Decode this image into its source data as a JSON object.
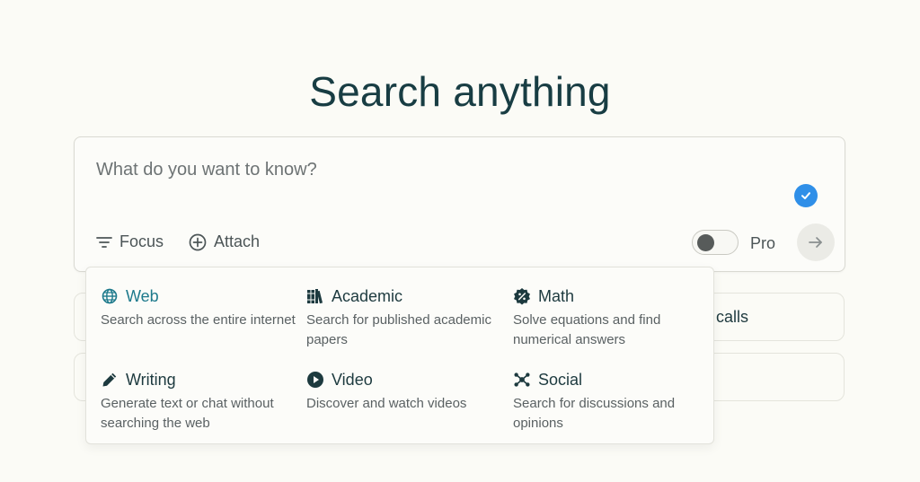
{
  "heading": "Search anything",
  "search": {
    "placeholder": "What do you want to know?",
    "focus_label": "Focus",
    "attach_label": "Attach",
    "pro_label": "Pro",
    "pro_enabled": false
  },
  "background_cards": [
    {
      "visible_text": "calls"
    },
    {
      "visible_text": ""
    }
  ],
  "focus_menu": {
    "options": [
      {
        "label": "Web",
        "description": "Search across the entire internet",
        "icon": "globe-icon",
        "selected": true
      },
      {
        "label": "Academic",
        "description": "Search for published academic papers",
        "icon": "books-icon",
        "selected": false
      },
      {
        "label": "Math",
        "description": "Solve equations and find numerical answers",
        "icon": "percent-badge-icon",
        "selected": false
      },
      {
        "label": "Writing",
        "description": "Generate text or chat without searching the web",
        "icon": "pencil-icon",
        "selected": false
      },
      {
        "label": "Video",
        "description": "Discover and watch videos",
        "icon": "play-circle-icon",
        "selected": false
      },
      {
        "label": "Social",
        "description": "Search for discussions and opinions",
        "icon": "network-icon",
        "selected": false
      }
    ]
  },
  "colors": {
    "background": "#fbfbf6",
    "title": "#183d43",
    "selected_option": "#1e7a8c",
    "check_badge": "#2f8fe8"
  }
}
